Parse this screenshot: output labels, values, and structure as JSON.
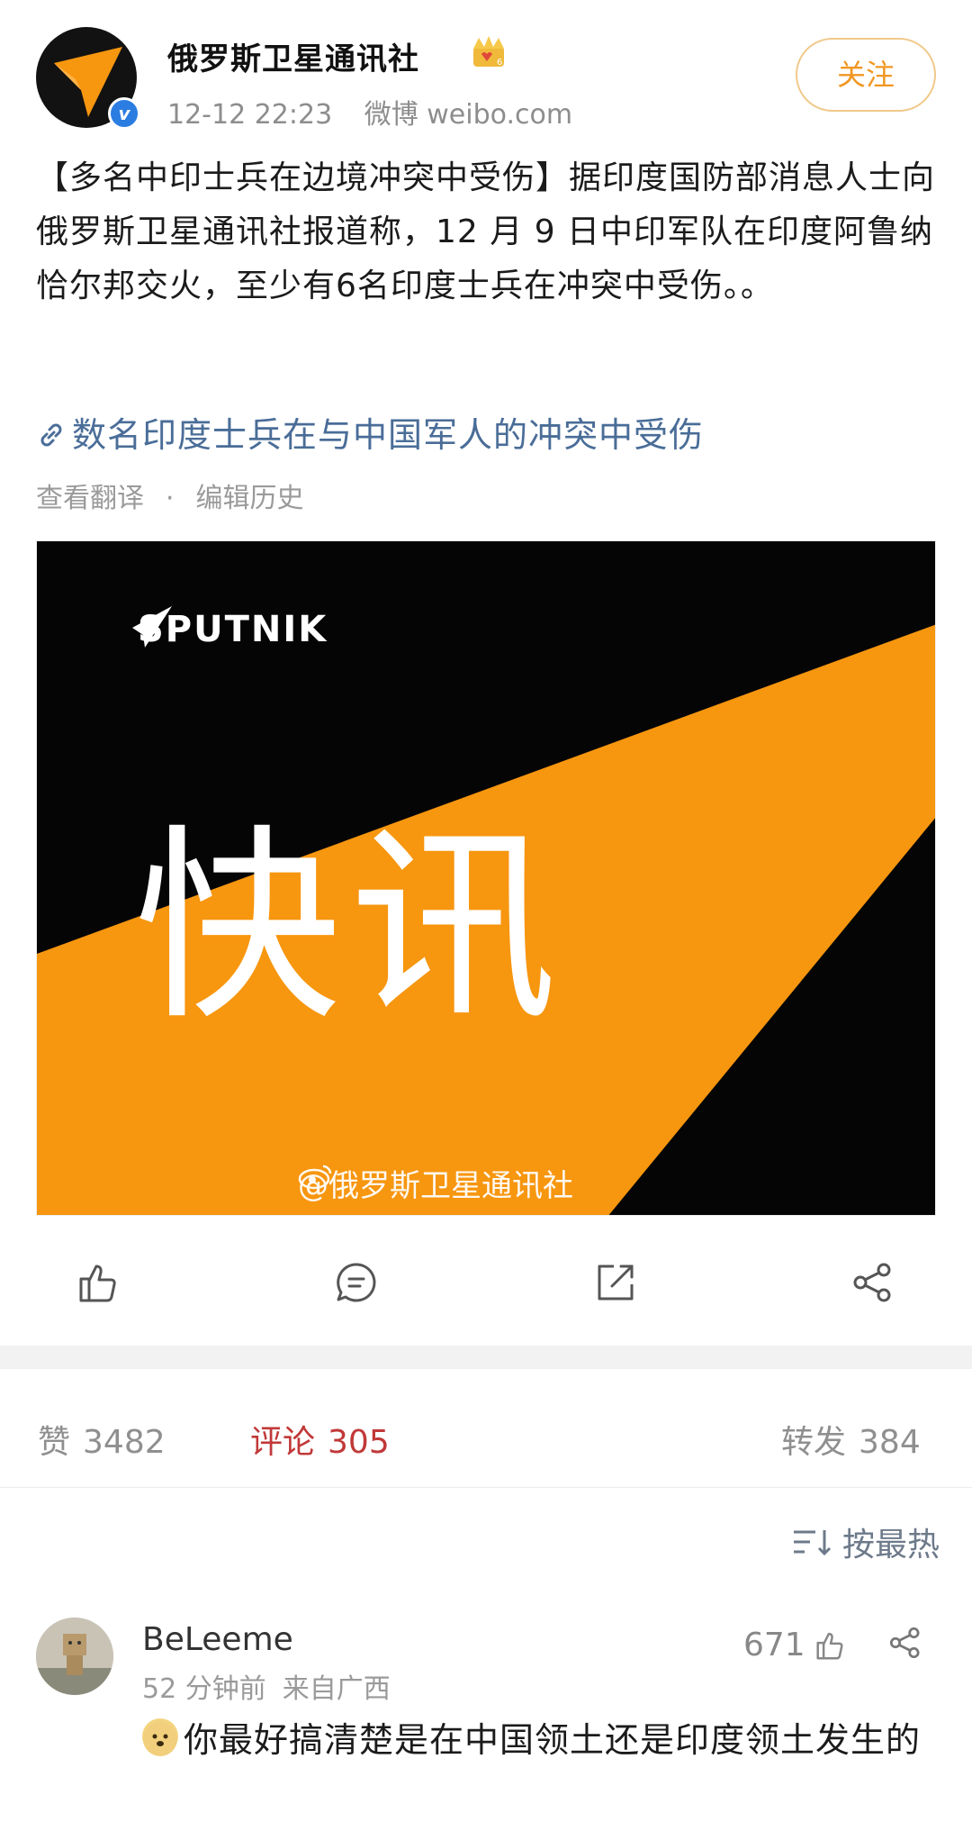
{
  "post": {
    "author": "俄罗斯卫星通讯社",
    "time": "12-12 22:23",
    "source": "微博 weibo.com",
    "follow_label": "关注",
    "verified_mark": "v",
    "text": "【多名中印士兵在边境冲突中受伤】据印度国防部消息人士向俄罗斯卫星通讯社报道称，12 月 9 日中印军队在印度阿鲁纳恰尔邦交火，至少有6名印度士兵在冲突中受伤。。",
    "link_text": "数名印度士兵在与中国军人的冲突中受伤",
    "translate_label": "查看翻译",
    "separator_dot": "·",
    "edit_history_label": "编辑历史",
    "image": {
      "brand": "SPUTNIK",
      "headline": "快讯",
      "watermark": "@俄罗斯卫星通讯社",
      "colors": {
        "orange": "#f7960f",
        "black": "#050505"
      }
    }
  },
  "actions": [
    {
      "name": "like",
      "icon": "thumbs-up-icon"
    },
    {
      "name": "comment",
      "icon": "comment-icon"
    },
    {
      "name": "repost",
      "icon": "repost-icon"
    },
    {
      "name": "share",
      "icon": "share-icon"
    }
  ],
  "stats": {
    "likes_label": "赞",
    "likes": "3482",
    "comments_label": "评论",
    "comments": "305",
    "reposts_label": "转发",
    "reposts": "384"
  },
  "sort_label": "按最热",
  "comment": {
    "user": "BeLeeme",
    "time": "52 分钟前",
    "location": "来自广西",
    "likes": "671",
    "text": "你最好搞清楚是在中国领土还是印度领土发生的"
  },
  "colors": {
    "accent_red": "#c13838",
    "link_blue": "#4a6d98",
    "follow_orange": "#f19722"
  }
}
